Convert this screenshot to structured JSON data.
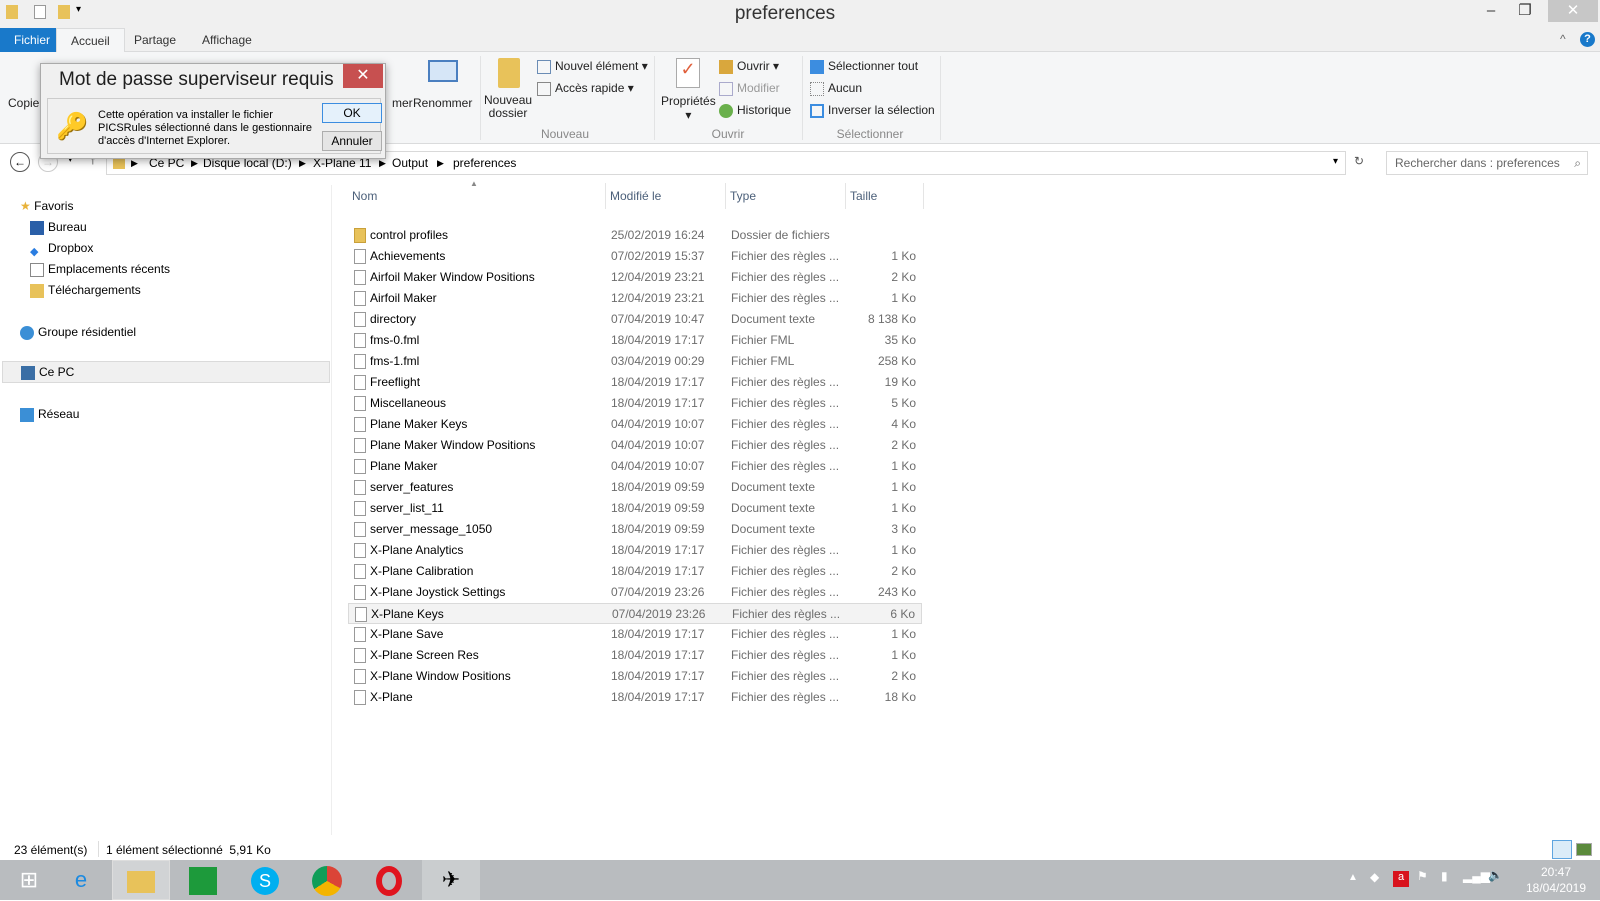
{
  "window": {
    "title": "preferences"
  },
  "tabs": [
    "Fichier",
    "Accueil",
    "Partage",
    "Affichage"
  ],
  "ribbon": {
    "copy": "Copier",
    "delete_partial": "mer",
    "rename": "Renommer",
    "new_folder": [
      "Nouveau",
      "dossier"
    ],
    "new_item": "Nouvel élément",
    "quick_access": "Accès rapide",
    "group_new": "Nouveau",
    "properties": "Propriétés",
    "open": "Ouvrir",
    "edit": "Modifier",
    "history": "Historique",
    "group_open": "Ouvrir",
    "select_all": "Sélectionner tout",
    "select_none": "Aucun",
    "invert": "Inverser la sélection",
    "group_select": "Sélectionner"
  },
  "address": {
    "crumbs": [
      "Ce PC",
      "Disque local (D:)",
      "X-Plane 11",
      "Output",
      "preferences"
    ],
    "search_placeholder": "Rechercher dans : preferences"
  },
  "nav": {
    "favorites": "Favoris",
    "desktop": "Bureau",
    "dropbox": "Dropbox",
    "recent": "Emplacements récents",
    "downloads": "Téléchargements",
    "homegroup": "Groupe résidentiel",
    "pc": "Ce PC",
    "network": "Réseau"
  },
  "columns": {
    "name": "Nom",
    "date": "Modifié le",
    "type": "Type",
    "size": "Taille"
  },
  "files": [
    {
      "name": "control profiles",
      "date": "25/02/2019 16:24",
      "type": "Dossier de fichiers",
      "size": "",
      "folder": true
    },
    {
      "name": "Achievements",
      "date": "07/02/2019 15:37",
      "type": "Fichier des règles ...",
      "size": "1 Ko"
    },
    {
      "name": "Airfoil Maker Window Positions",
      "date": "12/04/2019 23:21",
      "type": "Fichier des règles ...",
      "size": "2 Ko"
    },
    {
      "name": "Airfoil Maker",
      "date": "12/04/2019 23:21",
      "type": "Fichier des règles ...",
      "size": "1 Ko"
    },
    {
      "name": "directory",
      "date": "07/04/2019 10:47",
      "type": "Document texte",
      "size": "8 138 Ko"
    },
    {
      "name": "fms-0.fml",
      "date": "18/04/2019 17:17",
      "type": "Fichier FML",
      "size": "35 Ko"
    },
    {
      "name": "fms-1.fml",
      "date": "03/04/2019 00:29",
      "type": "Fichier FML",
      "size": "258 Ko"
    },
    {
      "name": "Freeflight",
      "date": "18/04/2019 17:17",
      "type": "Fichier des règles ...",
      "size": "19 Ko"
    },
    {
      "name": "Miscellaneous",
      "date": "18/04/2019 17:17",
      "type": "Fichier des règles ...",
      "size": "5 Ko"
    },
    {
      "name": "Plane Maker Keys",
      "date": "04/04/2019 10:07",
      "type": "Fichier des règles ...",
      "size": "4 Ko"
    },
    {
      "name": "Plane Maker Window Positions",
      "date": "04/04/2019 10:07",
      "type": "Fichier des règles ...",
      "size": "2 Ko"
    },
    {
      "name": "Plane Maker",
      "date": "04/04/2019 10:07",
      "type": "Fichier des règles ...",
      "size": "1 Ko"
    },
    {
      "name": "server_features",
      "date": "18/04/2019 09:59",
      "type": "Document texte",
      "size": "1 Ko"
    },
    {
      "name": "server_list_11",
      "date": "18/04/2019 09:59",
      "type": "Document texte",
      "size": "1 Ko"
    },
    {
      "name": "server_message_1050",
      "date": "18/04/2019 09:59",
      "type": "Document texte",
      "size": "3 Ko"
    },
    {
      "name": "X-Plane Analytics",
      "date": "18/04/2019 17:17",
      "type": "Fichier des règles ...",
      "size": "1 Ko"
    },
    {
      "name": "X-Plane Calibration",
      "date": "18/04/2019 17:17",
      "type": "Fichier des règles ...",
      "size": "2 Ko"
    },
    {
      "name": "X-Plane Joystick Settings",
      "date": "07/04/2019 23:26",
      "type": "Fichier des règles ...",
      "size": "243 Ko"
    },
    {
      "name": "X-Plane Keys",
      "date": "07/04/2019 23:26",
      "type": "Fichier des règles ...",
      "size": "6 Ko",
      "selected": true
    },
    {
      "name": "X-Plane Save",
      "date": "18/04/2019 17:17",
      "type": "Fichier des règles ...",
      "size": "1 Ko"
    },
    {
      "name": "X-Plane Screen Res",
      "date": "18/04/2019 17:17",
      "type": "Fichier des règles ...",
      "size": "1 Ko"
    },
    {
      "name": "X-Plane Window Positions",
      "date": "18/04/2019 17:17",
      "type": "Fichier des règles ...",
      "size": "2 Ko"
    },
    {
      "name": "X-Plane",
      "date": "18/04/2019 17:17",
      "type": "Fichier des règles ...",
      "size": "18 Ko"
    }
  ],
  "status": {
    "count": "23 élément(s)",
    "selection": "1 élément sélectionné  5,91 Ko"
  },
  "dialog": {
    "title": "Mot de passe superviseur requis",
    "message": "Cette opération va installer le fichier PICSRules sélectionné dans le gestionnaire d'accès d'Internet Explorer.",
    "ok": "OK",
    "cancel": "Annuler"
  },
  "clock": {
    "time": "20:47",
    "date": "18/04/2019"
  },
  "colors": {
    "accent": "#1979ca",
    "close": "#c75050"
  }
}
